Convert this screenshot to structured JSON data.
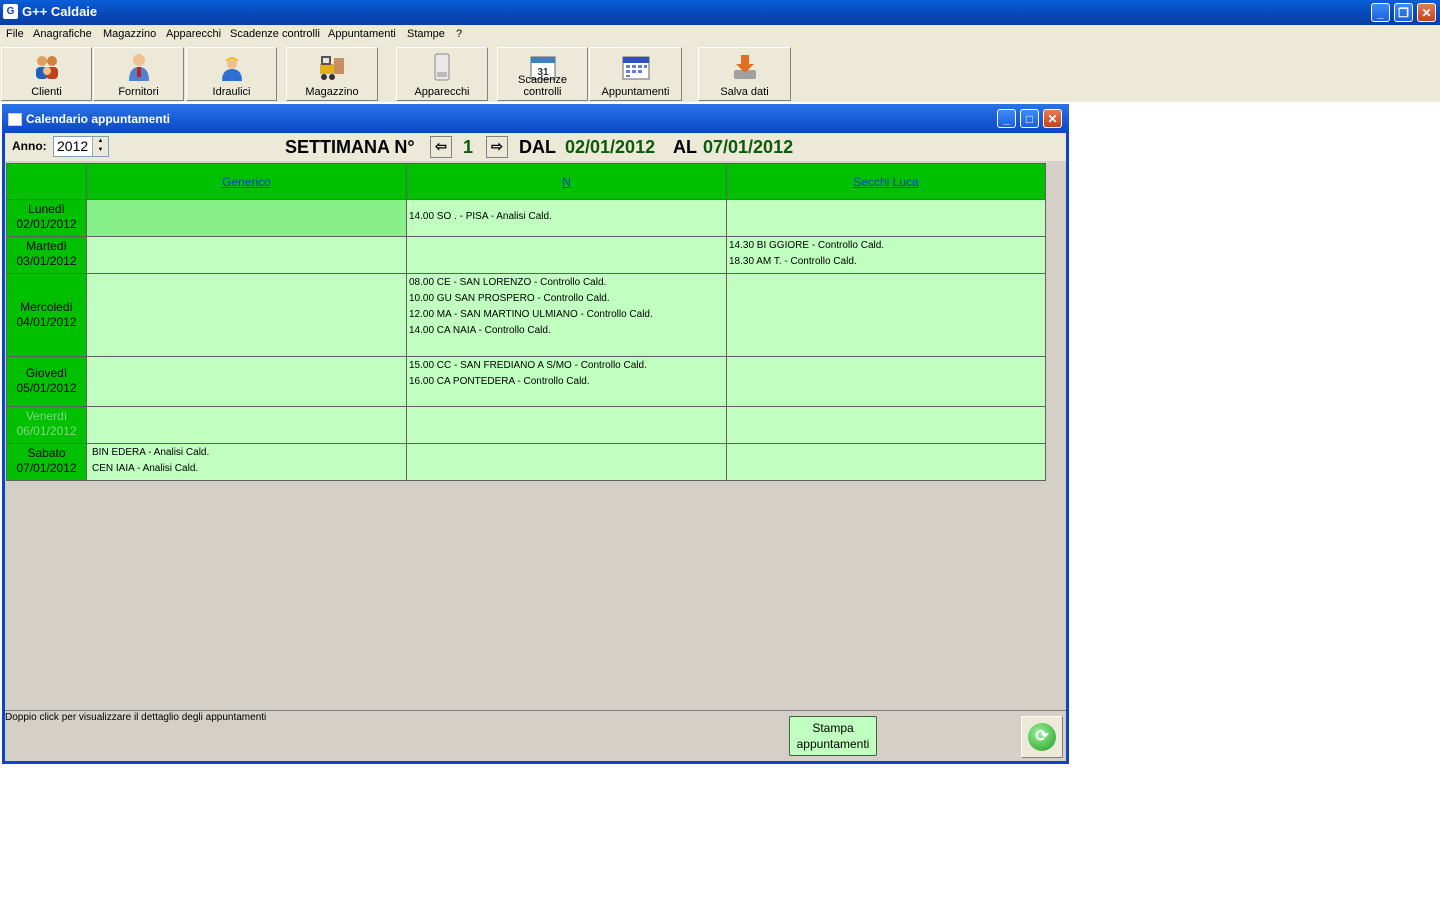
{
  "app": {
    "title": "G++ Caldaie"
  },
  "menu": [
    "File",
    "Anagrafiche",
    "Magazzino",
    "Apparecchi",
    "Scadenze controlli",
    "Appuntamenti",
    "Stampe",
    "?"
  ],
  "toolbar": [
    "Clienti",
    "Fornitori",
    "Idraulici",
    "Magazzino",
    "Apparecchi",
    "Scadenze controlli",
    "Appuntamenti",
    "Salva dati"
  ],
  "window": {
    "title": "Calendario appuntamenti"
  },
  "week": {
    "anno_label": "Anno:",
    "anno_value": "2012",
    "settimana_label": "SETTIMANA N°",
    "number": "1",
    "dal_label": "DAL",
    "dal_value": "02/01/2012",
    "al_label": "AL",
    "al_value": "07/01/2012"
  },
  "columns": [
    "Generico",
    "N",
    "Secchi Luca"
  ],
  "days": [
    {
      "name": "Lunedì",
      "date": "02/01/2012"
    },
    {
      "name": "Martedì",
      "date": "03/01/2012"
    },
    {
      "name": "Mercoledì",
      "date": "04/01/2012"
    },
    {
      "name": "Giovedì",
      "date": "05/01/2012"
    },
    {
      "name": "Venerdì",
      "date": "06/01/2012"
    },
    {
      "name": "Sabato",
      "date": "07/01/2012"
    }
  ],
  "appointments": {
    "mon_col2": [
      "14.00 SO . - PISA - Analisi Cald."
    ],
    "tue_col3": [
      "14.30 BI GGIORE - Controllo Cald.",
      "18.30 AM T. - Controllo Cald."
    ],
    "wed_col2": [
      "08.00 CE - SAN LORENZO - Controllo Cald.",
      "10.00 GU SAN PROSPERO - Controllo Cald.",
      "12.00 MA - SAN MARTINO ULMIANO - Controllo Cald.",
      "14.00 CA NAIA - Controllo Cald."
    ],
    "thu_col2": [
      "15.00 CC - SAN FREDIANO A S/MO - Controllo Cald.",
      "16.00 CA PONTEDERA - Controllo Cald."
    ],
    "sat_col1": [
      "BIN EDERA - Analisi Cald.",
      "CEN IAIA - Analisi Cald."
    ]
  },
  "footer": {
    "status": "Doppio click per visualizzare il dettaglio degli appuntamenti",
    "print_label": "Stampa appuntamenti"
  },
  "colors": {
    "header_green": "#00c000",
    "cell_green": "#c0ffc0",
    "date_green": "#0a5a0a"
  }
}
